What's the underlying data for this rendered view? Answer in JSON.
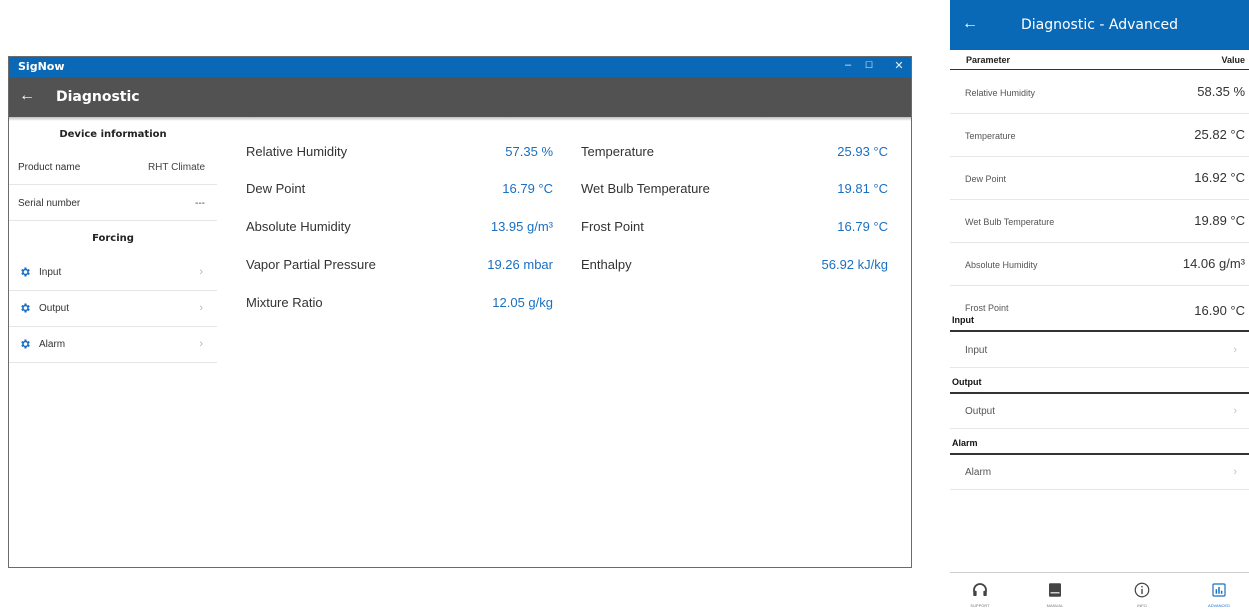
{
  "window": {
    "title": "SigNow",
    "controls": {
      "minimize": "–",
      "maximize": "☐",
      "close": "✕"
    },
    "appbar": {
      "back_icon": "arrow-left-icon",
      "back": "←",
      "title": "Diagnostic"
    }
  },
  "sidebar": {
    "device_info_title": "Device information",
    "product_label": "Product name",
    "product_value": "RHT Climate",
    "serial_label": "Serial number",
    "serial_value": "---",
    "forcing_title": "Forcing",
    "nav": [
      {
        "label": "Input",
        "icon": "gear-icon"
      },
      {
        "label": "Output",
        "icon": "gear-icon"
      },
      {
        "label": "Alarm",
        "icon": "gear-icon"
      }
    ],
    "chevron": "›"
  },
  "measurements": {
    "left": [
      {
        "label": "Relative Humidity",
        "value": "57.35 %"
      },
      {
        "label": "Dew Point",
        "value": "16.79 °C"
      },
      {
        "label": "Absolute Humidity",
        "value": "13.95 g/m³"
      },
      {
        "label": "Vapor Partial Pressure",
        "value": "19.26 mbar"
      },
      {
        "label": "Mixture Ratio",
        "value": "12.05 g/kg"
      }
    ],
    "right": [
      {
        "label": "Temperature",
        "value": "25.93 °C"
      },
      {
        "label": "Wet Bulb Temperature",
        "value": "19.81 °C"
      },
      {
        "label": "Frost Point",
        "value": "16.79 °C"
      },
      {
        "label": "Enthalpy",
        "value": "56.92 kJ/kg"
      }
    ]
  },
  "mobile": {
    "back": "←",
    "title": "Diagnostic - Advanced",
    "col_parameter": "Parameter",
    "col_value": "Value",
    "rows": [
      {
        "label": "Relative Humidity",
        "value": "58.35 %"
      },
      {
        "label": "Temperature",
        "value": "25.82 °C"
      },
      {
        "label": "Dew Point",
        "value": "16.92 °C"
      },
      {
        "label": "Wet Bulb Temperature",
        "value": "19.89 °C"
      },
      {
        "label": "Absolute Humidity",
        "value": "14.06 g/m³"
      },
      {
        "label": "Frost Point",
        "value": "16.90 °C"
      }
    ],
    "sections": [
      {
        "title": "Input",
        "item": "Input"
      },
      {
        "title": "Output",
        "item": "Output"
      },
      {
        "title": "Alarm",
        "item": "Alarm"
      }
    ],
    "chevron": "›",
    "tabs": [
      {
        "label": "SUPPORT",
        "icon": "headset-icon"
      },
      {
        "label": "MANUAL",
        "icon": "book-icon"
      },
      {
        "label": "INFO",
        "icon": "info-icon"
      },
      {
        "label": "ADVANCED",
        "icon": "chart-icon"
      }
    ],
    "colors": {
      "brand": "#0a69b7",
      "value_blue": "#1b6fc0",
      "appbar": "#525252"
    }
  }
}
